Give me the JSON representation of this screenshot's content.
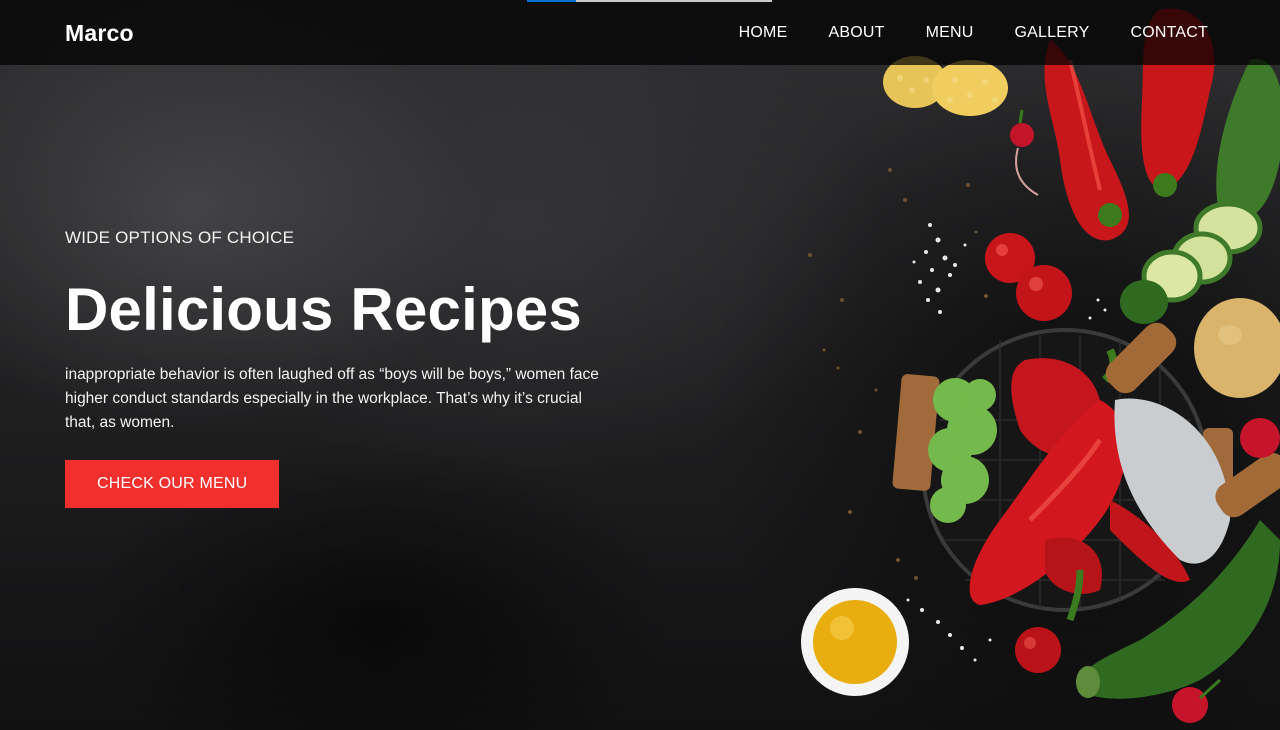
{
  "navbar": {
    "brand": "Marco",
    "menu": [
      {
        "label": "HOME"
      },
      {
        "label": "ABOUT"
      },
      {
        "label": "MENU"
      },
      {
        "label": "GALLERY"
      },
      {
        "label": "CONTACT"
      }
    ]
  },
  "hero": {
    "eyebrow": "WIDE OPTIONS OF CHOICE",
    "title": "Delicious Recipes",
    "description": "inappropriate behavior is often laughed off as “boys will be boys,” women face higher conduct standards especially in the workplace. That’s why it’s crucial that, as women.",
    "cta_label": "CHECK OUR MENU"
  },
  "colors": {
    "accent": "#f1302e",
    "navbar_bg": "rgba(0,0,0,0.72)",
    "progress_fill": "#0b6fd4"
  },
  "top_progress": {
    "fraction": 0.2
  },
  "imagery": [
    "corn-icon",
    "red-pepper-icon",
    "zucchini-icon",
    "radish-icon",
    "tomato-icon",
    "salt-icon",
    "potato-icon",
    "lettuce-icon",
    "wire-basket-icon",
    "herb-chopper-icon",
    "oil-bowl-icon"
  ]
}
